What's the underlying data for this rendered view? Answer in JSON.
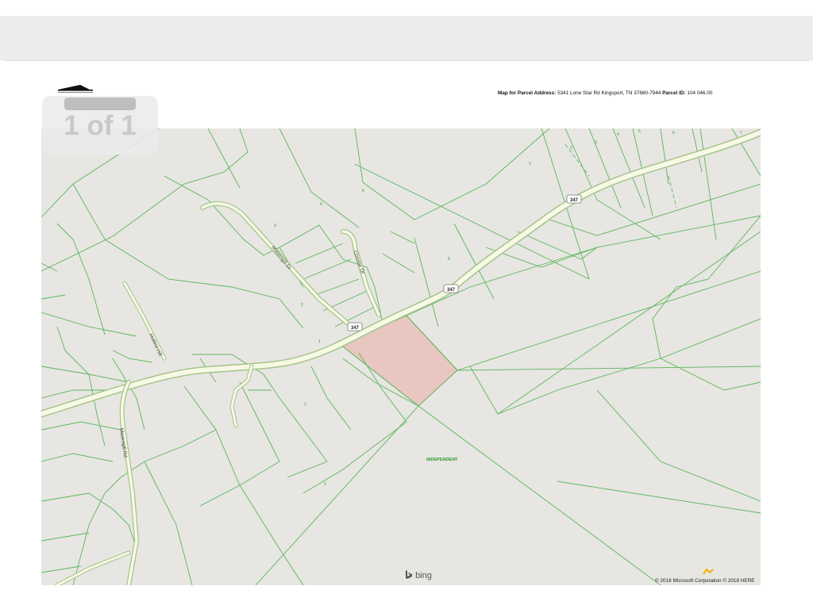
{
  "viewer": {
    "page_indicator": "1 of 1"
  },
  "document": {
    "header_label_1": "Map for Parcel Address:",
    "header_address": "5341 Lone Star Rd Kingsport, TN 37660-7944",
    "header_label_2": "Parcel ID:",
    "header_parcel_id": "104   046.00"
  },
  "map": {
    "roads": {
      "main_road_shield": "347",
      "labels": [
        "Masengill Dr",
        "Christie Dr",
        "Hollins Hill",
        "Masengill Rd"
      ]
    },
    "district_label": "INDEPENDENT",
    "lot_numbers": [
      "6",
      "4",
      "5",
      "3",
      "2",
      "1",
      "1",
      "2",
      "3",
      "4",
      "5",
      "6",
      "7",
      "2",
      "1"
    ],
    "colors": {
      "background": "#e7e6e2",
      "parcel_lines": "#5cb55c",
      "road_fill": "#f7f9e6",
      "road_casing": "#a4c48c",
      "selected_parcel": "#e9c7c0",
      "district_text": "#2e9a2e"
    }
  },
  "attribution": {
    "bing": "bing",
    "copyright": "© 2018 Microsoft Corporation © 2018 HERE"
  }
}
